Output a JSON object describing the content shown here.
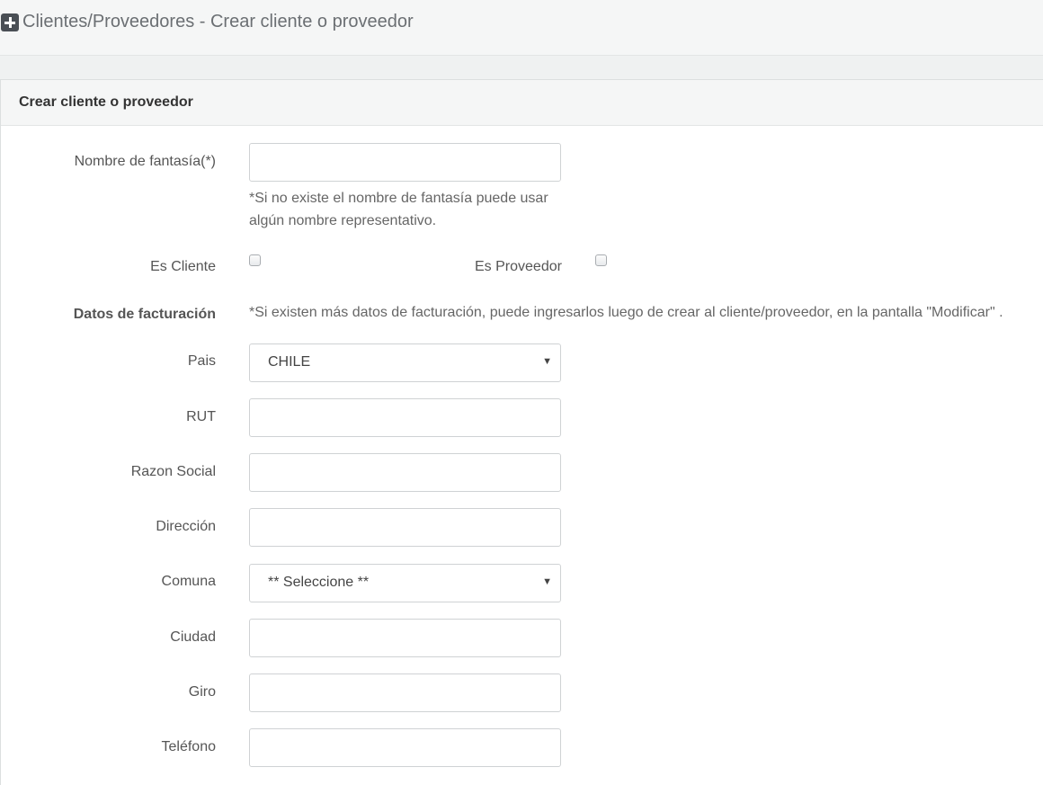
{
  "header": {
    "title": "Clientes/Proveedores - Crear cliente o proveedor",
    "icon": "plus-square-icon"
  },
  "panel": {
    "title": "Crear cliente o proveedor"
  },
  "form": {
    "nombre_fantasia": {
      "label": "Nombre de fantasía(*)",
      "value": "",
      "help_line1": "*Si no existe el nombre de fantasía puede usar",
      "help_line2": "algún nombre representativo."
    },
    "es_cliente": {
      "label": "Es Cliente",
      "checked": false
    },
    "es_proveedor": {
      "label": "Es Proveedor",
      "checked": false
    },
    "facturacion": {
      "label": "Datos de facturación",
      "note": "*Si existen más datos de facturación, puede ingresarlos luego de crear al cliente/proveedor, en la pantalla \"Modificar\" ."
    },
    "pais": {
      "label": "Pais",
      "selected": "CHILE"
    },
    "rut": {
      "label": "RUT",
      "value": ""
    },
    "razon_social": {
      "label": "Razon Social",
      "value": ""
    },
    "direccion": {
      "label": "Dirección",
      "value": ""
    },
    "comuna": {
      "label": "Comuna",
      "selected": "** Seleccione **"
    },
    "ciudad": {
      "label": "Ciudad",
      "value": ""
    },
    "giro": {
      "label": "Giro",
      "value": ""
    },
    "telefono": {
      "label": "Teléfono",
      "value": ""
    }
  },
  "colors": {
    "header_bg": "#f5f6f6",
    "border": "#cfd2d4",
    "text": "#555555"
  }
}
